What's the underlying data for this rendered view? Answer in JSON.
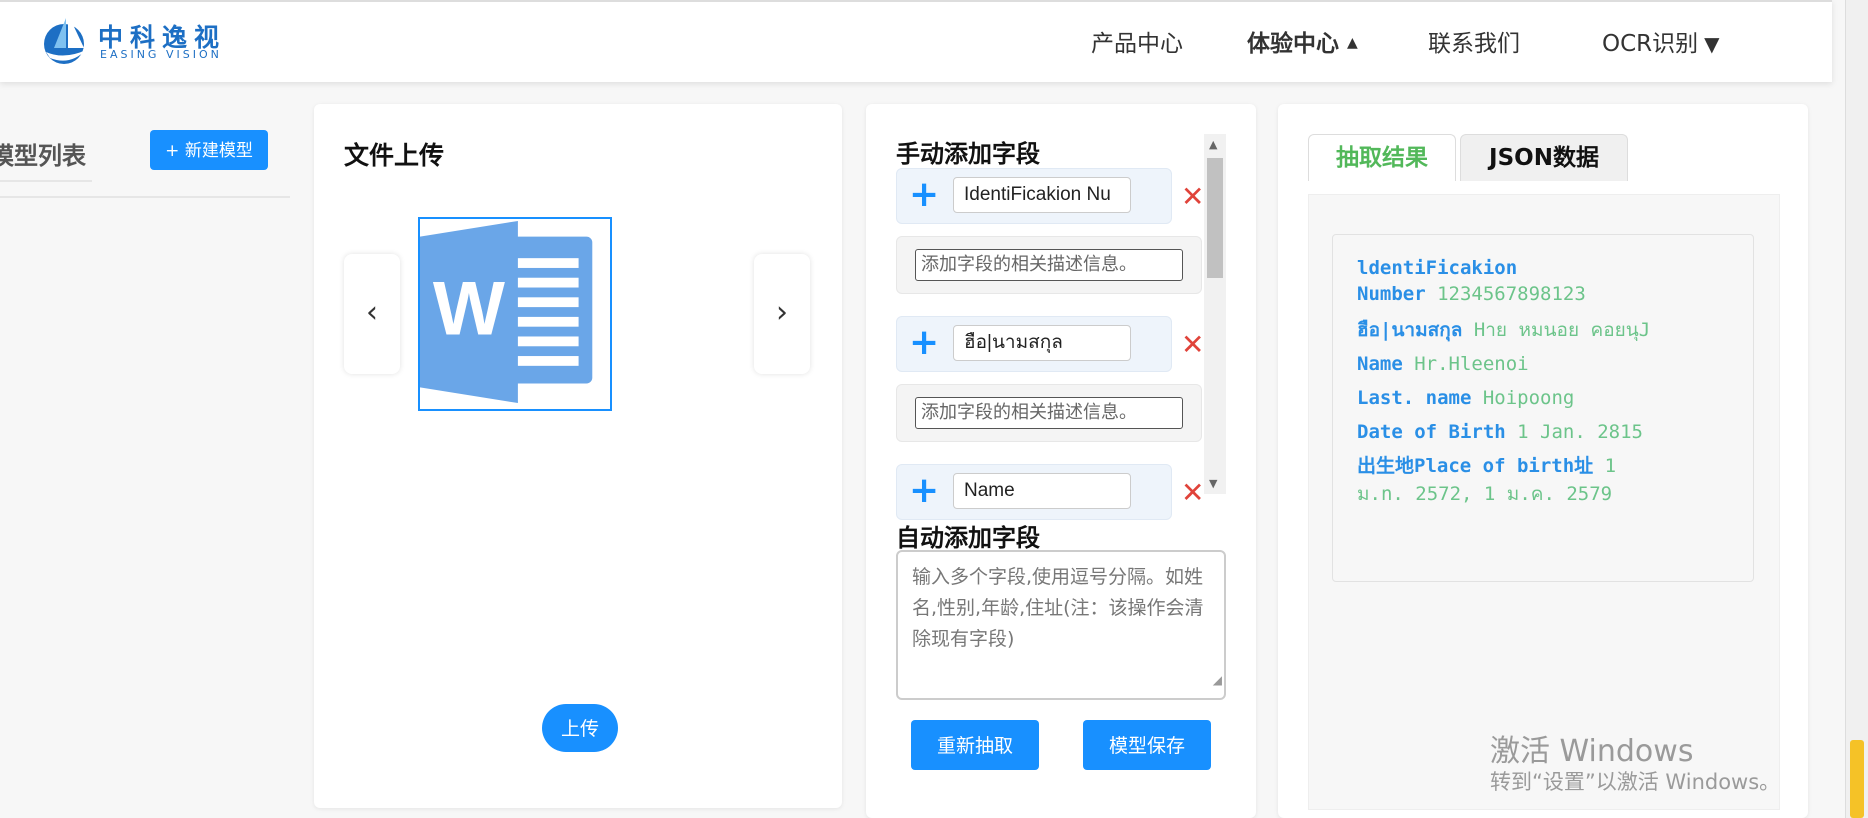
{
  "brand": {
    "name_cn": "中科逸视",
    "name_en": "EASING VISION"
  },
  "nav": {
    "items": [
      {
        "label": "产品中心"
      },
      {
        "label": "体验中心"
      },
      {
        "label": "联系我们"
      },
      {
        "label": "OCR识别"
      }
    ],
    "caret_up": "▲",
    "caret_down": "▼"
  },
  "models": {
    "title": "模型列表",
    "new_button": "+ 新建模型"
  },
  "upload": {
    "title": "文件上传",
    "prev": "‹",
    "next": "›",
    "file_icon": "word-document-icon",
    "upload_button": "上传"
  },
  "fields": {
    "title": "手动添加字段",
    "desc_placeholder": "添加字段的相关描述信息。",
    "items": [
      {
        "name": "IdentiFicakion Nu"
      },
      {
        "name": "ฮือ|นามสกุล"
      },
      {
        "name": "Name"
      }
    ],
    "add_icon": "+",
    "remove_icon": "✕"
  },
  "auto": {
    "title": "自动添加字段",
    "placeholder": "输入多个字段,使用逗号分隔。如姓名,性别,年龄,住址(注：该操作会清除现有字段)",
    "reextract_button": "重新抽取",
    "save_button": "模型保存"
  },
  "result": {
    "tabs": [
      {
        "label": "抽取结果"
      },
      {
        "label": "JSON数据"
      }
    ],
    "rows": [
      {
        "key_line1": "ldentiFicakion",
        "key_line2": "Number",
        "value": "1234567898123"
      },
      {
        "key": "ฮือ|นามสกุล",
        "value": "Hาย หมนอย คอยนุJ"
      },
      {
        "key": "Name",
        "value": " Hr.Hleenoi"
      },
      {
        "key": "Last. name",
        "value": "Hoipoong"
      },
      {
        "key": "Date of Birth",
        "value": "1 Jan. 2815"
      },
      {
        "key": "出生地Place of birth址",
        "value_line1": " 1",
        "value_line2": "ม.n. 2572, 1 ม.ค. 2579"
      }
    ]
  },
  "watermark": {
    "line1": "激活 Windows",
    "line2": "转到“设置”以激活 Windows。"
  },
  "colors": {
    "accent": "#1890ff",
    "result_key": "#2a8fe6",
    "result_value": "#6cc48a",
    "remove": "#e0433a"
  }
}
